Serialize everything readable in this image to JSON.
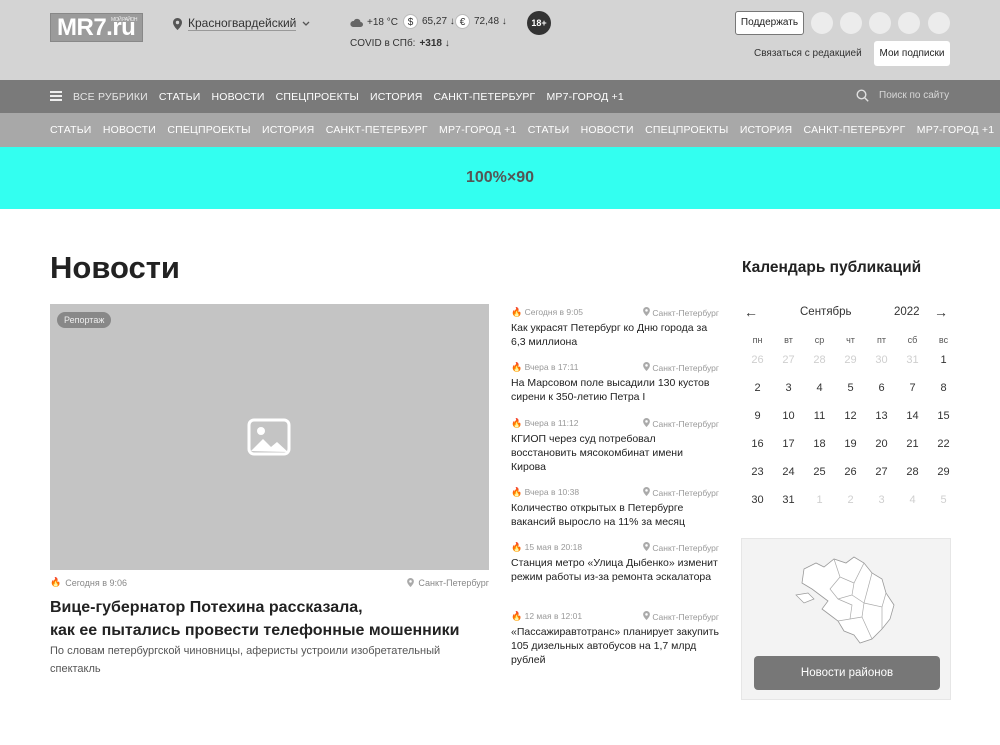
{
  "header": {
    "logo_text": "MR7.ru",
    "logo_sub": "МОЙ РАЙОН",
    "location": "Красногвардейский",
    "weather": "+18 °C",
    "usd_symbol": "$",
    "usd": "65,27 ↓",
    "eur_symbol": "€",
    "eur": "72,48 ↓",
    "covid_label": "COVID в СПб:",
    "covid_value": "+318 ↓",
    "age_rating": "18+",
    "support_label": "Поддержать",
    "contact_label": "Связаться с редакцией",
    "subscriptions_label": "Мои подписки"
  },
  "nav_primary": {
    "all_rubrics": "ВСЕ РУБРИКИ",
    "items": [
      "СТАТЬИ",
      "НОВОСТИ",
      "СПЕЦПРОЕКТЫ",
      "ИСТОРИЯ",
      "САНКТ-ПЕТЕРБУРГ",
      "МР7-ГОРОД +1"
    ],
    "search_placeholder": "Поиск по сайту"
  },
  "nav_secondary": {
    "items": [
      "СТАТЬИ",
      "НОВОСТИ",
      "СПЕЦПРОЕКТЫ",
      "ИСТОРИЯ",
      "САНКТ-ПЕТЕРБУРГ",
      "МР7-ГОРОД +1",
      "СТАТЬИ",
      "НОВОСТИ",
      "СПЕЦПРОЕКТЫ",
      "ИСТОРИЯ",
      "САНКТ-ПЕТЕРБУРГ",
      "МР7-ГОРОД +1"
    ]
  },
  "banner": {
    "label": "100%×90"
  },
  "page": {
    "title": "Новости"
  },
  "main_story": {
    "tag": "Репортаж",
    "time": "Сегодня в 9:06",
    "location": "Санкт-Петербург",
    "headline_1": "Вице-губернатор Потехина рассказала,",
    "headline_2": "как ее пытались провести телефонные мошенники",
    "lead": "По словам петербургской чиновницы, аферисты устроили изобретательный спектакль"
  },
  "news": [
    {
      "time": "Сегодня в 9:05",
      "location": "Санкт-Петербург",
      "title": "Как украсят Петербург ко Дню города за 6,3 миллиона"
    },
    {
      "time": "Вчера в 17:11",
      "location": "Санкт-Петербург",
      "title": "На Марсовом поле высадили 130 кустов сирени к 350-летию Петра I"
    },
    {
      "time": "Вчера в 11:12",
      "location": "Санкт-Петербург",
      "title": "КГИОП через суд потребовал восстановить мясокомбинат имени Кирова"
    },
    {
      "time": "Вчера в 10:38",
      "location": "Санкт-Петербург",
      "title": "Количество открытых в Петербурге вакансий выросло на 11% за месяц"
    },
    {
      "time": "15 мая в 20:18",
      "location": "Санкт-Петербург",
      "title": "Станция метро «Улица Дыбенко» изменит режим работы из-за ремонта эскалатора"
    },
    {
      "time": "12 мая в 12:01",
      "location": "Санкт-Петербург",
      "title": "«Пассажиравтотранс» планирует закупить 105 дизельных автобусов на 1,7 млрд рублей"
    }
  ],
  "calendar": {
    "title": "Календарь публикаций",
    "month": "Сентябрь",
    "year": "2022",
    "prev": "←",
    "next": "→",
    "weekdays": [
      "пн",
      "вт",
      "ср",
      "чт",
      "пт",
      "сб",
      "вс"
    ],
    "days": [
      {
        "d": "26",
        "m": true
      },
      {
        "d": "27",
        "m": true
      },
      {
        "d": "28",
        "m": true
      },
      {
        "d": "29",
        "m": true
      },
      {
        "d": "30",
        "m": true
      },
      {
        "d": "31",
        "m": true
      },
      {
        "d": "1",
        "m": false
      },
      {
        "d": "2",
        "m": false
      },
      {
        "d": "3",
        "m": false
      },
      {
        "d": "4",
        "m": false
      },
      {
        "d": "5",
        "m": false
      },
      {
        "d": "6",
        "m": false
      },
      {
        "d": "7",
        "m": false
      },
      {
        "d": "8",
        "m": false
      },
      {
        "d": "9",
        "m": false
      },
      {
        "d": "10",
        "m": false
      },
      {
        "d": "11",
        "m": false
      },
      {
        "d": "12",
        "m": false
      },
      {
        "d": "13",
        "m": false
      },
      {
        "d": "14",
        "m": false
      },
      {
        "d": "15",
        "m": false
      },
      {
        "d": "16",
        "m": false
      },
      {
        "d": "17",
        "m": false
      },
      {
        "d": "18",
        "m": false
      },
      {
        "d": "19",
        "m": false
      },
      {
        "d": "20",
        "m": false
      },
      {
        "d": "21",
        "m": false
      },
      {
        "d": "22",
        "m": false
      },
      {
        "d": "23",
        "m": false
      },
      {
        "d": "24",
        "m": false
      },
      {
        "d": "25",
        "m": false
      },
      {
        "d": "26",
        "m": false
      },
      {
        "d": "27",
        "m": false
      },
      {
        "d": "28",
        "m": false
      },
      {
        "d": "29",
        "m": false
      },
      {
        "d": "30",
        "m": false
      },
      {
        "d": "31",
        "m": false
      },
      {
        "d": "1",
        "m": true
      },
      {
        "d": "2",
        "m": true
      },
      {
        "d": "3",
        "m": true
      },
      {
        "d": "4",
        "m": true
      },
      {
        "d": "5",
        "m": true
      }
    ]
  },
  "districts": {
    "button_label": "Новости районов"
  },
  "colors": {
    "header_bg": "#d4d4d4",
    "nav_primary_bg": "#7a7a7a",
    "nav_secondary_bg": "#a8a8a8",
    "banner_bg": "#33fff0",
    "accent_flame": "#f08020"
  }
}
